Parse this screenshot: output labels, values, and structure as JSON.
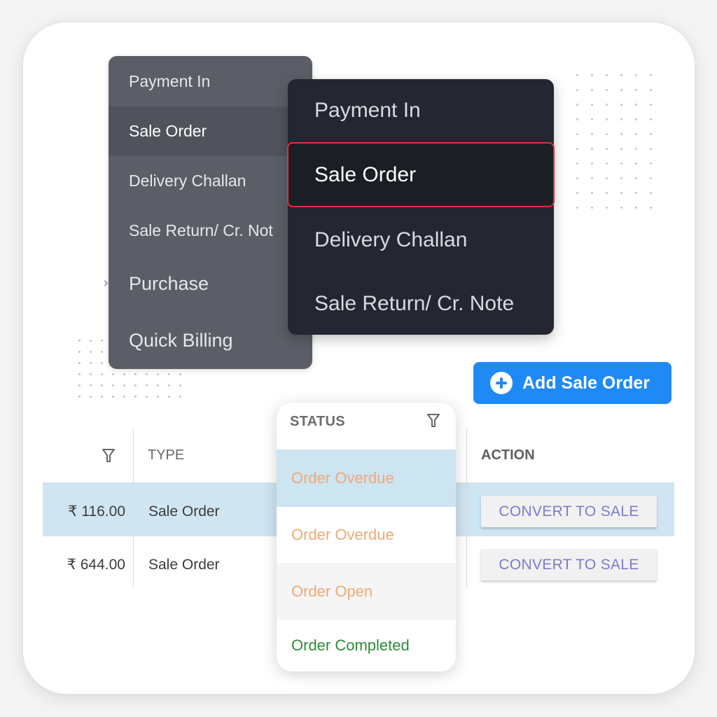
{
  "back_menu": {
    "items": [
      {
        "label": "Payment In",
        "active": false
      },
      {
        "label": "Sale Order",
        "active": true
      },
      {
        "label": "Delivery Challan",
        "active": false
      },
      {
        "label": "Sale Return/ Cr. Not",
        "active": false
      },
      {
        "label": "Purchase",
        "active": false
      },
      {
        "label": "Quick Billing",
        "active": false
      }
    ]
  },
  "front_menu": {
    "items": [
      {
        "label": "Payment In",
        "active": false
      },
      {
        "label": "Sale Order",
        "active": true
      },
      {
        "label": "Delivery Challan",
        "active": false
      },
      {
        "label": "Sale Return/ Cr. Note",
        "active": false
      }
    ],
    "highlight_color": "#e0323c"
  },
  "add_button": {
    "label": "Add Sale Order",
    "icon": "plus-circle-icon",
    "color": "#1f8af6"
  },
  "table": {
    "headers": {
      "amount_filter_icon": "filter-icon",
      "type": "TYPE",
      "status": "STATUS",
      "status_filter_icon": "filter-icon",
      "action": "ACTION"
    },
    "rows": [
      {
        "amount": "₹ 116.00",
        "type": "Sale Order",
        "action": "CONVERT TO SALE",
        "highlighted": true
      },
      {
        "amount": "₹ 644.00",
        "type": "Sale Order",
        "action": "CONVERT TO SALE",
        "highlighted": false
      }
    ],
    "highlight_color": "#cfe5f2"
  },
  "status_dropdown": {
    "header": "STATUS",
    "options": [
      {
        "label": "Order Overdue",
        "color": "#f0a877"
      },
      {
        "label": "Order Overdue",
        "color": "#f0a877"
      },
      {
        "label": "Order Open",
        "color": "#f0a877"
      },
      {
        "label": "Order Completed",
        "color": "#2e8b3a"
      }
    ]
  }
}
